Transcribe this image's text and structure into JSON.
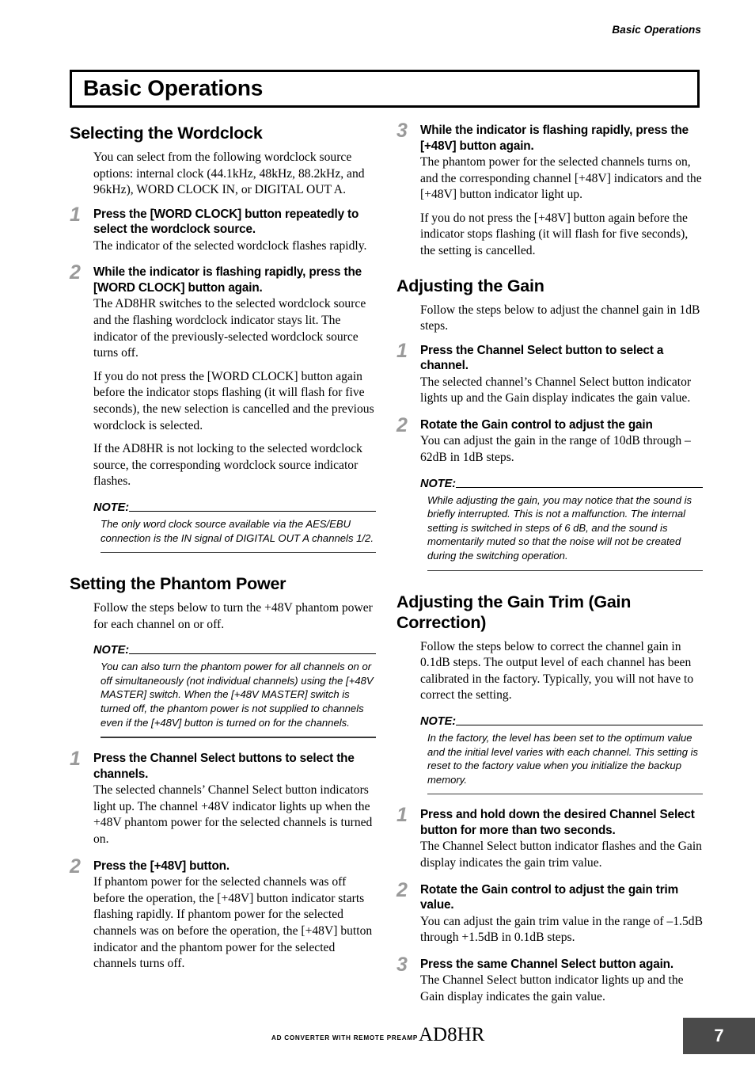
{
  "header": {
    "running_title": "Basic Operations",
    "chapter_title": "Basic Operations"
  },
  "footer": {
    "tagline": "AD CONVERTER WITH REMOTE PREAMP",
    "brand": "AD8HR",
    "page_number": "7",
    "page_box_color": "#4a4a4a"
  },
  "colors": {
    "step_number": "#9a9a9a",
    "text": "#000000",
    "rule": "#3a3a3a"
  },
  "left_column": {
    "section1": {
      "heading": "Selecting the Wordclock",
      "intro": "You can select from the following wordclock source options: internal clock (44.1kHz, 48kHz, 88.2kHz, and 96kHz), WORD CLOCK IN, or DIGITAL OUT A.",
      "step1": {
        "number": "1",
        "title": "Press the [WORD CLOCK] button repeatedly to select the wordclock source.",
        "body1": "The indicator of the selected wordclock flashes rapidly."
      },
      "step2": {
        "number": "2",
        "title": "While the indicator is flashing rapidly, press the [WORD CLOCK] button again.",
        "body1": "The AD8HR switches to the selected wordclock source and the flashing wordclock indicator stays lit. The indicator of the previously-selected wordclock source turns off.",
        "body2": "If you do not press the [WORD CLOCK] button again before the indicator stops flashing (it will flash for five seconds), the new selection is cancelled and the previous wordclock is selected.",
        "body3": "If the AD8HR is not locking to the selected wordclock source, the corresponding wordclock source indicator flashes."
      },
      "note": {
        "label": "NOTE:",
        "text": "The only word clock source available via the AES/EBU connection is the IN signal of DIGITAL OUT A channels 1/2."
      }
    },
    "section2": {
      "heading": "Setting the Phantom Power",
      "intro": "Follow the steps below to turn the +48V phantom power for each channel on or off.",
      "note": {
        "label": "NOTE:",
        "text": "You can also turn the phantom power for all channels on or off simultaneously (not individual channels) using the [+48V MASTER] switch. When the [+48V MASTER] switch is turned off, the phantom power is not supplied to channels even if the [+48V] button is turned on for the channels."
      },
      "step1": {
        "number": "1",
        "title": "Press the Channel Select buttons to select the channels.",
        "body1": "The selected channels’ Channel Select button indicators light up. The channel +48V indicator lights up when the +48V phantom power for the selected channels is turned on."
      },
      "step2": {
        "number": "2",
        "title": "Press the [+48V] button.",
        "body1": "If phantom power for the selected channels was off before the operation, the [+48V] button indicator starts flashing rapidly. If phantom power for the selected channels was on before the operation, the [+48V] button indicator and the phantom power for the selected channels turns off."
      }
    }
  },
  "right_column": {
    "continued_step3": {
      "number": "3",
      "title": "While the indicator is flashing rapidly, press the [+48V] button again.",
      "body1": "The phantom power for the selected channels turns on, and the corresponding channel [+48V] indicators and the [+48V] button indicator light up.",
      "body2": "If you do not press the [+48V] button again before the indicator stops flashing (it will flash for five seconds), the setting is cancelled."
    },
    "section3": {
      "heading": "Adjusting the Gain",
      "intro": "Follow the steps below to adjust the channel gain in 1dB steps.",
      "step1": {
        "number": "1",
        "title": "Press the Channel Select button to select a channel.",
        "body1": "The selected channel’s Channel Select button indicator lights up and the Gain display indicates the gain value."
      },
      "step2": {
        "number": "2",
        "title": "Rotate the Gain control to adjust the gain",
        "body1": "You can adjust the gain in the range of 10dB through –62dB in 1dB steps."
      },
      "note": {
        "label": "NOTE:",
        "text": "While adjusting the gain, you may notice that the sound is briefly interrupted. This is not a malfunction. The internal setting is switched in steps of 6 dB, and the sound is momentarily muted so that the noise will not be created during the switching operation."
      }
    },
    "section4": {
      "heading": "Adjusting the Gain Trim (Gain Correction)",
      "intro": "Follow the steps below to correct the channel gain in 0.1dB steps. The output level of each channel has been calibrated in the factory. Typically, you will not have to correct the setting.",
      "note": {
        "label": "NOTE:",
        "text": "In the factory, the level has been set to the optimum value and the initial level varies with each channel. This setting is reset to the factory value when you initialize the backup memory."
      },
      "step1": {
        "number": "1",
        "title": "Press and hold down the desired Channel Select button for more than two seconds.",
        "body1": "The Channel Select button indicator flashes and the Gain display indicates the gain trim value."
      },
      "step2": {
        "number": "2",
        "title": "Rotate the Gain control to adjust the gain trim value.",
        "body1": "You can adjust the gain trim value in the range of –1.5dB through +1.5dB in 0.1dB steps."
      },
      "step3": {
        "number": "3",
        "title": "Press the same Channel Select button again.",
        "body1": "The Channel Select button indicator lights up and the Gain display indicates the gain value."
      }
    }
  }
}
